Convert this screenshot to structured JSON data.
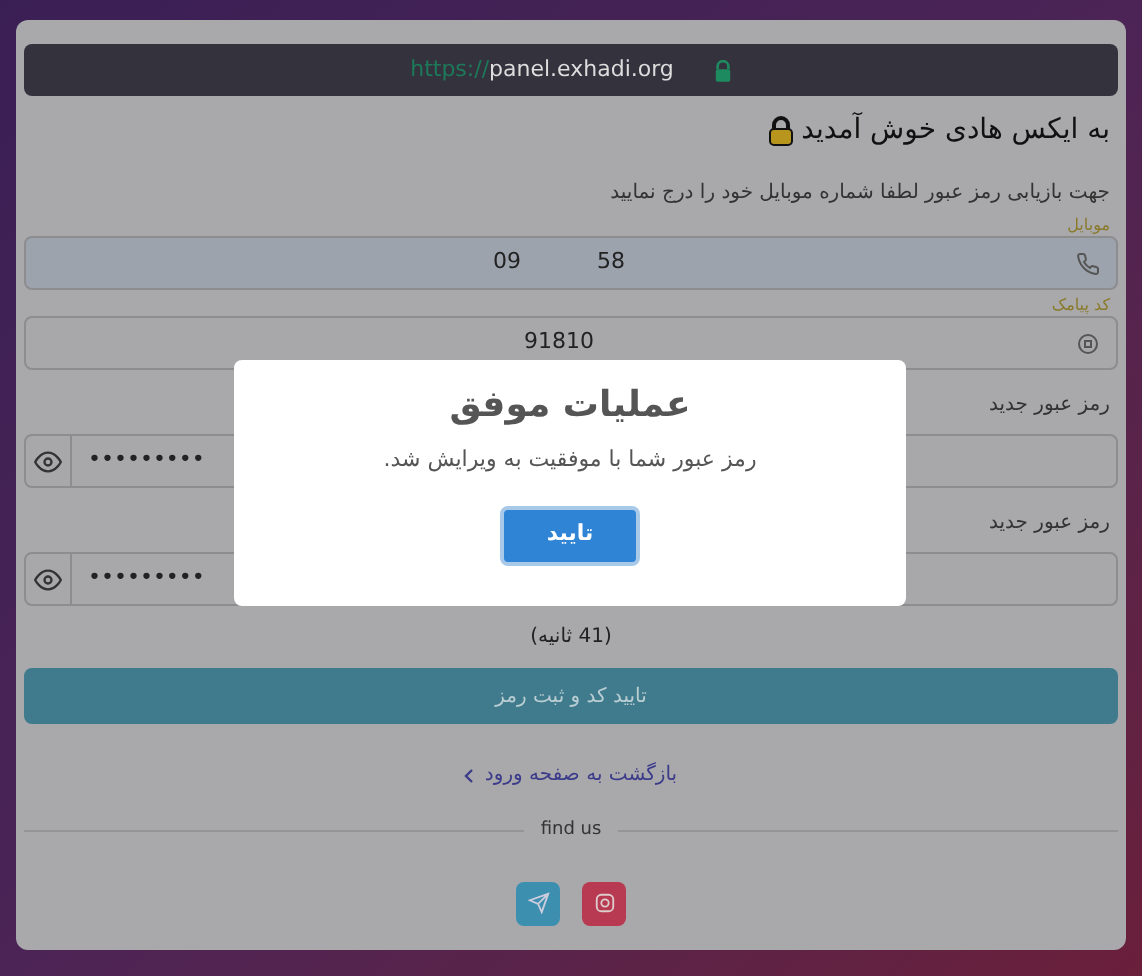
{
  "url_bar": {
    "scheme": "https://",
    "host": "panel.exhadi.org"
  },
  "title": "به ایکس هادی خوش آمدید",
  "subtitle": "جهت بازیابی رمز عبور لطفا شماره موبایل خود را درج نمایید",
  "fields": [
    {
      "kind": "phone",
      "label": "موبایل",
      "value_start": "09",
      "value_end": "58"
    },
    {
      "kind": "code",
      "label": "کد پیامک",
      "value": "91810"
    },
    {
      "kind": "password",
      "label": "رمز عبور جدید",
      "value": "•••••••••"
    },
    {
      "kind": "password",
      "label": "رمز عبور جدید",
      "value": "•••••••••"
    }
  ],
  "countdown": "(41 ثانیه)",
  "submit_button": "تایید کد و ثبت رمز",
  "back_link": "بازگشت به صفحه ورود",
  "find_us": "find us",
  "socials": [
    {
      "kind": "telegram",
      "color": "#3d8fb0"
    },
    {
      "kind": "instagram",
      "color": "#b83a52"
    }
  ],
  "dialog": {
    "title": "عملیات موفق",
    "message": "رمز عبور شما با موفقیت به ویرایش شد.",
    "button": "تایید"
  }
}
